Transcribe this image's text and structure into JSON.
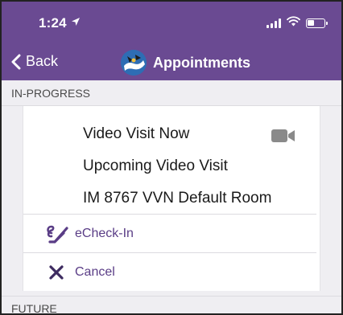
{
  "status_bar": {
    "time": "1:24",
    "icons": [
      "location-arrow-icon",
      "signal-icon",
      "wifi-icon",
      "battery-icon"
    ]
  },
  "nav": {
    "back_label": "Back",
    "title": "Appointments"
  },
  "sections": {
    "in_progress": "IN-PROGRESS",
    "future": "FUTURE"
  },
  "appointment": {
    "line1": "Video Visit Now",
    "line2": "Upcoming Video Visit",
    "line3": "IM 8767 VVN Default Room",
    "icon": "video-camera-icon"
  },
  "actions": {
    "echeckin": "eCheck-In",
    "cancel": "Cancel"
  },
  "colors": {
    "header_purple": "#6a4a92",
    "action_text": "#5a3d86",
    "background": "#efeef2"
  }
}
